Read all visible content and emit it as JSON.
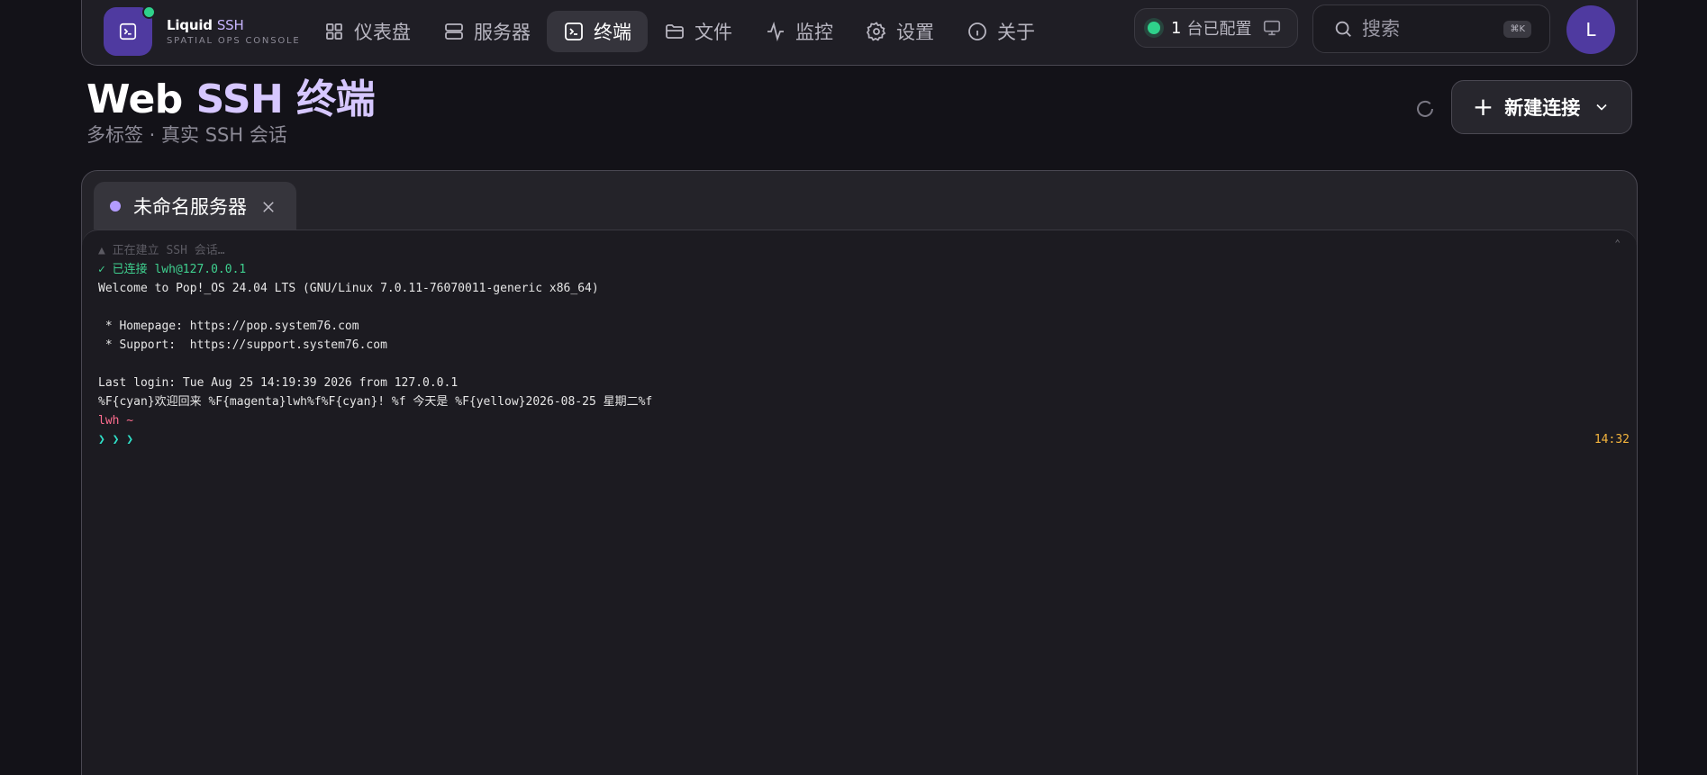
{
  "brand": {
    "name": "Liquid",
    "name_accent": "SSH",
    "subtitle": "SPATIAL OPS CONSOLE"
  },
  "nav": {
    "items": [
      {
        "label": "仪表盘",
        "icon": "grid-icon"
      },
      {
        "label": "服务器",
        "icon": "server-icon"
      },
      {
        "label": "终端",
        "icon": "terminal-icon",
        "active": true
      },
      {
        "label": "文件",
        "icon": "folder-icon"
      },
      {
        "label": "监控",
        "icon": "activity-icon"
      },
      {
        "label": "设置",
        "icon": "gear-icon"
      },
      {
        "label": "关于",
        "icon": "info-icon"
      }
    ]
  },
  "config": {
    "count": "1",
    "label": "台已配置"
  },
  "search": {
    "placeholder": "搜索",
    "shortcut": "⌘K"
  },
  "user": {
    "avatar_initial": "L"
  },
  "page": {
    "title_prefix": "Web",
    "title_accent": "SSH 终端",
    "subtitle": "多标签 · 真实 SSH 会话",
    "new_connection_label": "新建连接"
  },
  "tabs": [
    {
      "label": "未命名服务器"
    }
  ],
  "terminal": {
    "lines": [
      "▲ 正在建立 SSH 会话…",
      "✓ 已连接 lwh@127.0.0.1",
      "Welcome to Pop!_OS 24.04 LTS (GNU/Linux 7.0.11-76070011-generic x86_64)",
      "",
      " * Homepage: https://pop.system76.com",
      " * Support:  https://support.system76.com",
      "",
      "Last login: Tue Aug 25 14:19:39 2026 from 127.0.0.1",
      "%F{cyan}欢迎回来 %F{magenta}lwh%f%F{cyan}! %f 今天是 %F{yellow}2026-08-25 星期二%f",
      "lwh ~",
      "❯ ❯ ❯"
    ],
    "time": "14:32",
    "scroll_indicator": "⌃"
  },
  "colors": {
    "accent": "#c7b5ff",
    "brand": "#4f3aa0",
    "status_ok": "#2fd18b",
    "time": "#f5b53d"
  }
}
